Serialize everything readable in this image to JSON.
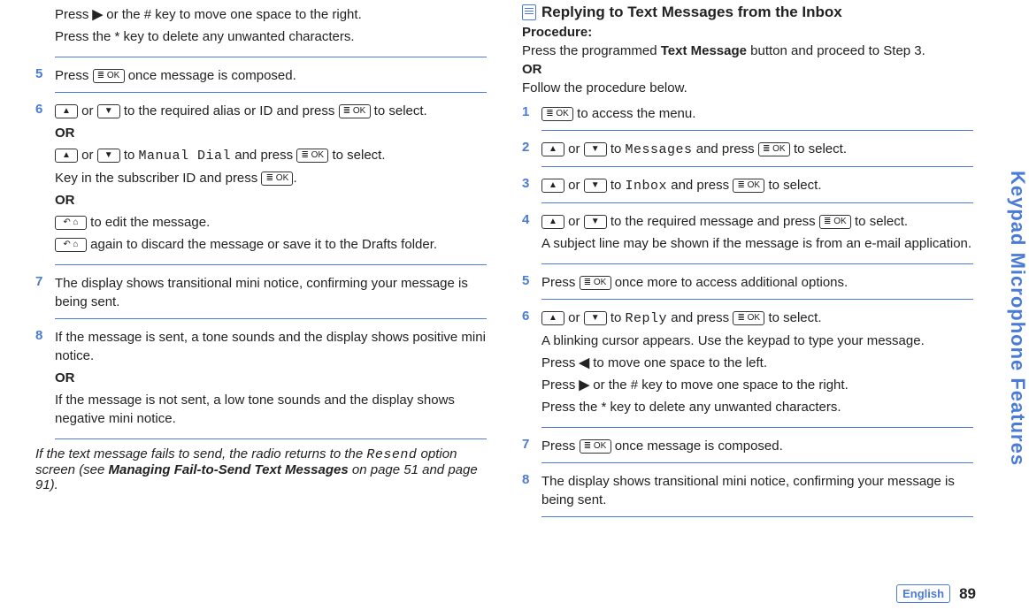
{
  "side_tab": "Keypad Microphone Features",
  "footer": {
    "lang": "English",
    "page": "89"
  },
  "icons": {
    "right_arrow": "▶",
    "left_arrow": "◀",
    "ok_key": "≣ OK",
    "up_key": "▲",
    "down_key": "▼",
    "back_key": "↶ ⌂"
  },
  "left": {
    "pre_step_a": "or the # key to move one space to the right.",
    "pre_step_a_prefix": "Press",
    "pre_step_b": "Press the * key to delete any unwanted characters.",
    "s5": {
      "num": "5",
      "a": "Press",
      "b": "once message is composed."
    },
    "s6": {
      "num": "6",
      "l1_a": "or",
      "l1_b": "to the required alias or ID and press",
      "l1_c": "to select.",
      "or1": "OR",
      "l2_a": "or",
      "l2_b": "to",
      "l2_mono": "Manual Dial",
      "l2_c": "and press",
      "l2_d": "to select.",
      "l3_a": "Key in the subscriber ID and press",
      "l3_b": ".",
      "or2": "OR",
      "l4": "to edit the message.",
      "l5": "again to discard the message or save it to the Drafts folder."
    },
    "s7": {
      "num": "7",
      "text": "The display shows transitional mini notice, confirming your message is being sent."
    },
    "s8": {
      "num": "8",
      "l1": "If the message is sent, a tone sounds and the display shows positive mini notice.",
      "or": "OR",
      "l2": "If the message is not sent, a low tone sounds and the display shows negative mini notice."
    },
    "tail_a": "If the text message fails to send, the radio returns to the ",
    "tail_mono": "Resend",
    "tail_b": " option screen (see ",
    "tail_bold": "Managing Fail-to-Send Text Messages",
    "tail_c": " on page 51 and page 91)."
  },
  "right": {
    "heading": "Replying to Text Messages from the Inbox",
    "proc_label": "Procedure:",
    "proc_a": "Press the programmed ",
    "proc_bold": "Text Message",
    "proc_b": " button and proceed to Step 3.",
    "or": "OR",
    "proc_c": "Follow the procedure below.",
    "s1": {
      "num": "1",
      "text": "to access the menu."
    },
    "s2": {
      "num": "2",
      "a": "or",
      "b": "to",
      "mono": "Messages",
      "c": "and press",
      "d": "to select."
    },
    "s3": {
      "num": "3",
      "a": "or",
      "b": "to",
      "mono": "Inbox",
      "c": "and press",
      "d": "to select."
    },
    "s4": {
      "num": "4",
      "a": "or",
      "b": "to the required message and press",
      "c": "to select.",
      "l2": "A subject line may be shown if the message is from an e-mail application."
    },
    "s5": {
      "num": "5",
      "a": "Press",
      "b": "once more to access additional options."
    },
    "s6": {
      "num": "6",
      "a": "or",
      "b": "to",
      "mono": "Reply",
      "c": "and press",
      "d": "to select.",
      "l2": "A blinking cursor appears. Use the keypad to type your message.",
      "l3a": "Press",
      "l3b": "to move one space to the left.",
      "l4a": "Press",
      "l4b": "or the # key to move one space to the right.",
      "l5": "Press the * key to delete any unwanted characters."
    },
    "s7": {
      "num": "7",
      "a": "Press",
      "b": "once message is composed."
    },
    "s8": {
      "num": "8",
      "text": "The display shows transitional mini notice, confirming your message is being sent."
    }
  }
}
